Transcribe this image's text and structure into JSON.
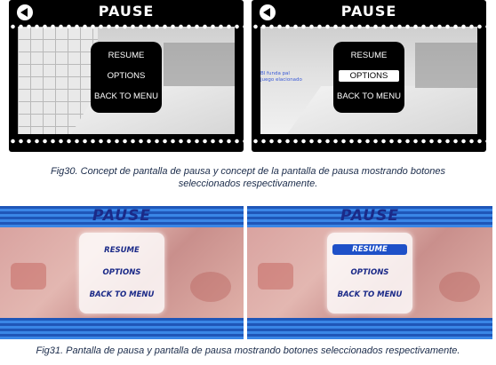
{
  "fig30": {
    "left": {
      "title": "PAUSE",
      "menu": [
        "RESUME",
        "OPTIONS",
        "BACK TO MENU"
      ]
    },
    "right": {
      "title": "PAUSE",
      "menu": [
        "RESUME",
        "OPTIONS",
        "BACK TO MENU"
      ],
      "selected": "OPTIONS",
      "tip": [
        "Bl funda pal",
        "juego elacionado"
      ]
    },
    "caption_line1": "Fig30. Concept de pantalla de pausa y concept de la pantalla de pausa mostrando botones",
    "caption_line2": "seleccionados respectivamente."
  },
  "fig31": {
    "left": {
      "title": "PAUSE",
      "menu": [
        "RESUME",
        "OPTIONS",
        "BACK TO MENU"
      ]
    },
    "right": {
      "title": "PAUSE",
      "menu": [
        "RESUME",
        "OPTIONS",
        "BACK TO MENU"
      ],
      "selected": "RESUME"
    },
    "caption": "Fig31. Pantalla de pausa y pantalla de pausa mostrando botones seleccionados respectivamente."
  },
  "colors": {
    "concept_bg": "#000000",
    "game_blue": "#2b6fd1",
    "title_blue": "#1b2a88",
    "selected_blue": "#1e50c8"
  }
}
